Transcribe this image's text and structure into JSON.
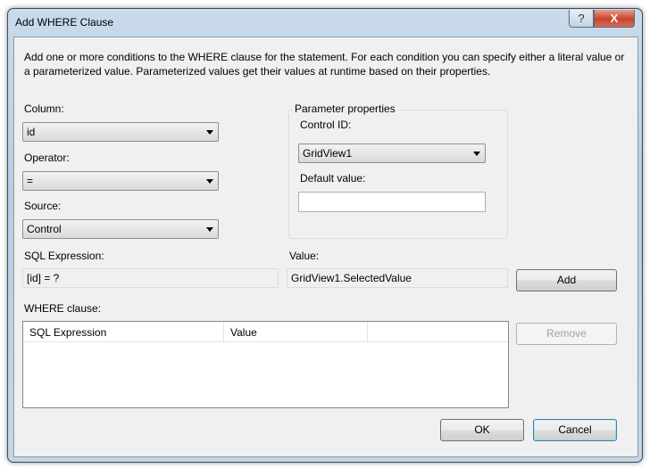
{
  "window": {
    "title": "Add WHERE Clause",
    "help": "?",
    "close": "X"
  },
  "description": "Add one or more conditions to the WHERE clause for the statement. For each condition you can specify either a literal value or a parameterized value. Parameterized values get their values at runtime based on their properties.",
  "column": {
    "label": "Column:",
    "value": "id"
  },
  "operator": {
    "label": "Operator:",
    "value": "="
  },
  "source": {
    "label": "Source:",
    "value": "Control"
  },
  "params": {
    "title": "Parameter properties",
    "control_label": "Control ID:",
    "control_value": "GridView1",
    "default_label": "Default value:",
    "default_value": ""
  },
  "sql": {
    "label": "SQL Expression:",
    "value": "[id] = ?"
  },
  "value": {
    "label": "Value:",
    "value": "GridView1.SelectedValue"
  },
  "buttons": {
    "add": "Add",
    "remove": "Remove",
    "ok": "OK",
    "cancel": "Cancel"
  },
  "where": {
    "label": "WHERE clause:",
    "columns": [
      "SQL Expression",
      "Value",
      ""
    ]
  }
}
